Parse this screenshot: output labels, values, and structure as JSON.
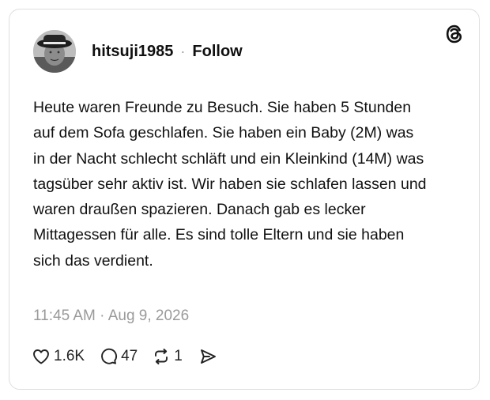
{
  "post": {
    "username": "hitsuji1985",
    "separator": "·",
    "follow_label": "Follow",
    "text": "Heute waren Freunde zu Besuch. Sie haben 5 Stunden auf dem Sofa geschlafen. Sie haben ein Baby (2M) was in der Nacht schlecht schläft und ein Kleinkind (14M) was tagsüber sehr aktiv ist. Wir haben sie schlafen lassen und waren draußen spazieren. Danach gab es lecker Mittagessen für alle. Es sind tolle Eltern und sie haben sich das verdient.",
    "timestamp": "11:45 AM · Aug 9, 2026"
  },
  "actions": {
    "likes": "1.6K",
    "replies": "47",
    "reposts": "1"
  },
  "icons": {
    "brand": "threads-logo-icon",
    "like": "heart-icon",
    "reply": "speech-bubble-icon",
    "repost": "repost-icon",
    "share": "send-icon"
  }
}
